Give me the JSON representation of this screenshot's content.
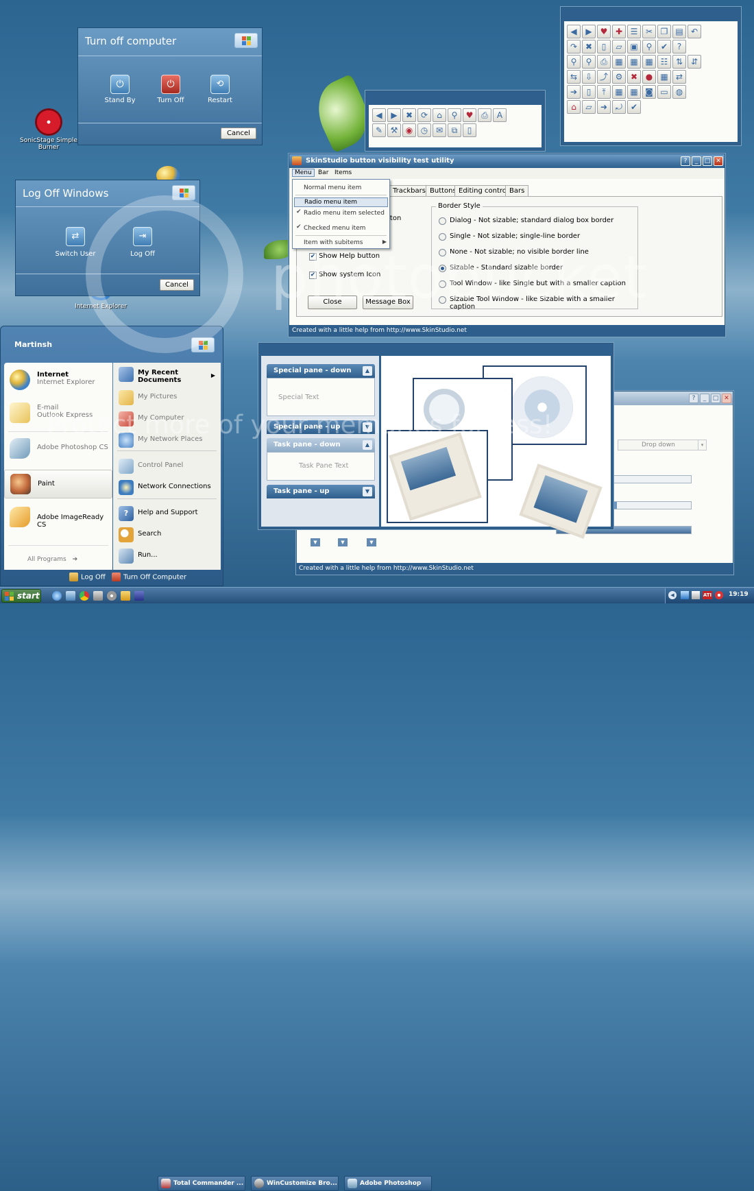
{
  "desktop": {
    "icons": [
      {
        "label": "SonicStage Simple Burner"
      },
      {
        "label": "Internet Explorer"
      }
    ]
  },
  "turn_off": {
    "title": "Turn off computer",
    "buttons": [
      "Stand By",
      "Turn Off",
      "Restart"
    ],
    "cancel": "Cancel"
  },
  "log_off": {
    "title": "Log Off Windows",
    "buttons": [
      "Switch User",
      "Log Off"
    ],
    "cancel": "Cancel"
  },
  "toolbar_small": {
    "icon_count": 16
  },
  "toolbar_large": {
    "icon_count": 50
  },
  "skinstudio": {
    "title": "SkinStudio button visibility test utility",
    "menubar": [
      "Menu",
      "Bar",
      "Items"
    ],
    "menu_items": [
      {
        "label": "Normal menu item",
        "checked": false
      },
      {
        "label": "Radio menu item",
        "checked": false,
        "highlighted": true
      },
      {
        "label": "Radio menu item selected",
        "checked": true
      },
      {
        "label": "Checked menu item",
        "checked": true
      },
      {
        "label": "Item with subitems",
        "checked": false,
        "submenu": true
      }
    ],
    "tabs": [
      "Trackbars",
      "Buttons",
      "Editing controls",
      "Bars"
    ],
    "partial_label": "tton",
    "checkboxes": [
      "Show Help button",
      "Show system Icon"
    ],
    "group_title": "Border Style",
    "radios": [
      {
        "label": "Dialog - Not sizable; standard dialog box border",
        "selected": false
      },
      {
        "label": "Single - Not sizable; single-line border",
        "selected": false
      },
      {
        "label": "None - Not sizable; no visible border line",
        "selected": false
      },
      {
        "label": "Sizable - Standard sizable border",
        "selected": true
      },
      {
        "label": "Tool Window - like Single but with a smaller caption",
        "selected": false
      },
      {
        "label": "Sizable Tool Window - like Sizable with a smaller caption",
        "selected": false
      }
    ],
    "buttons": [
      "Close",
      "Message Box"
    ],
    "status": "Created with a little help from http://www.SkinStudio.net"
  },
  "panes": {
    "items": [
      {
        "header": "Special pane - down",
        "content": "Special Text"
      },
      {
        "header": "Special pane - up",
        "content": ""
      },
      {
        "header": "Task pane - down",
        "content": "Task Pane Text"
      },
      {
        "header": "Task pane - up",
        "content": ""
      }
    ]
  },
  "back_window": {
    "dropdown": "Drop down",
    "status": "Created with a little help from http://www.SkinStudio.net"
  },
  "start_menu": {
    "user": "Martinsh",
    "left_items": [
      {
        "title": "Internet",
        "subtitle": "Internet Explorer",
        "color": "#3f82c6"
      },
      {
        "title": "E-mail",
        "subtitle": "Outlook Express",
        "color": "#e8c35a"
      },
      {
        "title": "Adobe Photoshop CS",
        "subtitle": "",
        "color": "#6f9ab8"
      },
      {
        "title": "Paint",
        "subtitle": "",
        "color": "#c0673a"
      },
      {
        "title": "Adobe ImageReady CS",
        "subtitle": "",
        "color": "#e59b2a"
      }
    ],
    "all_programs": "All Programs",
    "right_items": [
      {
        "label": "My Recent Documents",
        "color": "#3c6fb0"
      },
      {
        "label": "My Pictures",
        "color": "#e3b448"
      },
      {
        "label": "My Computer",
        "color": "#c8493a"
      },
      {
        "label": "My Network Places",
        "color": "#4a85c7"
      },
      {
        "label": "Control Panel",
        "color": "#7fa6c8"
      },
      {
        "label": "Network Connections",
        "color": "#3d7cc0"
      },
      {
        "label": "Help and Support",
        "color": "#2d5fa0"
      },
      {
        "label": "Search",
        "color": "#e1a33a"
      },
      {
        "label": "Run...",
        "color": "#5d88b4"
      }
    ],
    "log_off": "Log Off",
    "turn_off": "Turn Off Computer"
  },
  "taskbar": {
    "start": "start",
    "tasks": [
      "Total Commander ...",
      "WinCustomize Bro...",
      "Adobe Photoshop"
    ],
    "clock": "19:19"
  },
  "watermark": {
    "logo": "photobucket",
    "banner": "Protect more of your memories for less!"
  }
}
